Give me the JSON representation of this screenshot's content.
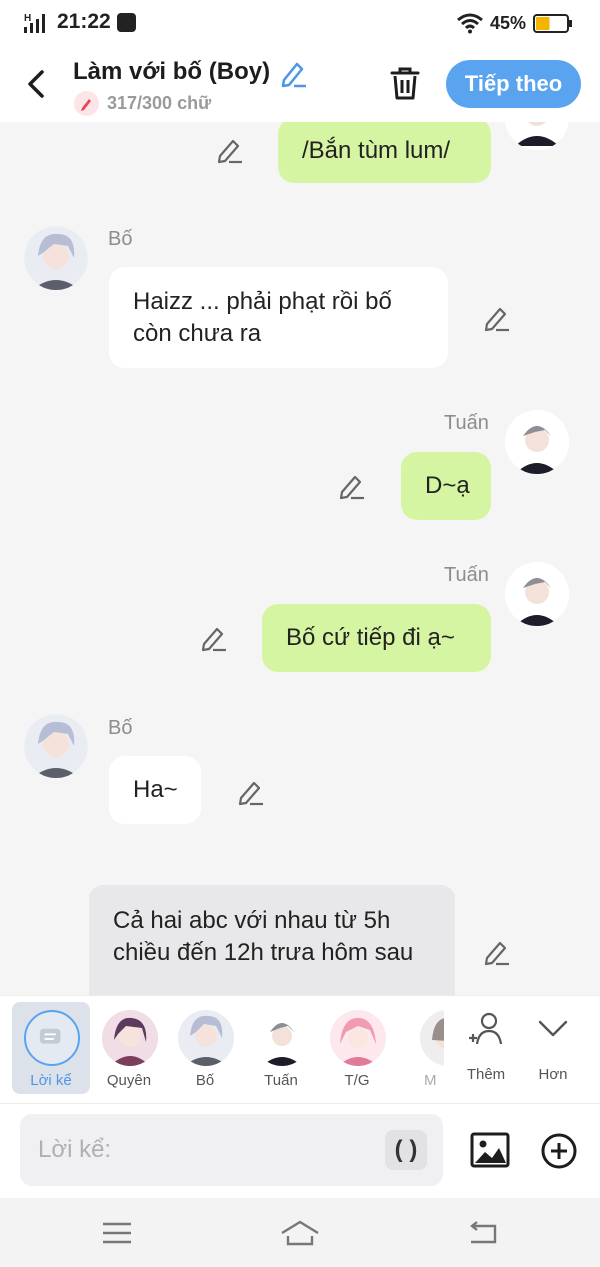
{
  "status": {
    "network": "H",
    "time": "21:22",
    "battery_pct": "45%",
    "battery_level": 0.45
  },
  "header": {
    "title": "Làm với bố (Boy)",
    "word_count": "317/300 chữ",
    "next_label": "Tiếp theo"
  },
  "chat": {
    "messages": [
      {
        "speaker": "",
        "text": "/Bắn tùm lum/"
      },
      {
        "speaker": "Bố",
        "text": "Haizz ... phải phạt rồi bố còn chưa ra"
      },
      {
        "speaker": "Tuấn",
        "text": "D~ạ"
      },
      {
        "speaker": "Tuấn",
        "text": "Bố cứ tiếp đi ạ~"
      },
      {
        "speaker": "Bố",
        "text": "Ha~"
      },
      {
        "speaker": "",
        "text": "Cả hai abc với nhau từ 5h chiều đến 12h trưa hôm sau"
      }
    ]
  },
  "characters": [
    {
      "label": "Lời kể",
      "selected": true
    },
    {
      "label": "Quyên"
    },
    {
      "label": "Bố"
    },
    {
      "label": "Tuấn"
    },
    {
      "label": "T/G"
    },
    {
      "label": "M"
    }
  ],
  "tools": [
    {
      "label": "Thêm",
      "icon": "add-person-icon"
    },
    {
      "label": "Hơn",
      "icon": "chevron-down-icon"
    }
  ],
  "input": {
    "placeholder": "Lời kể:",
    "paren_label": "( )"
  },
  "colors": {
    "accent": "#5aa4ef",
    "my_bubble": "#d6f5a3",
    "other_bubble": "#ffffff",
    "narration_bubble": "#e8e8ea",
    "battery": "#f5b400"
  }
}
